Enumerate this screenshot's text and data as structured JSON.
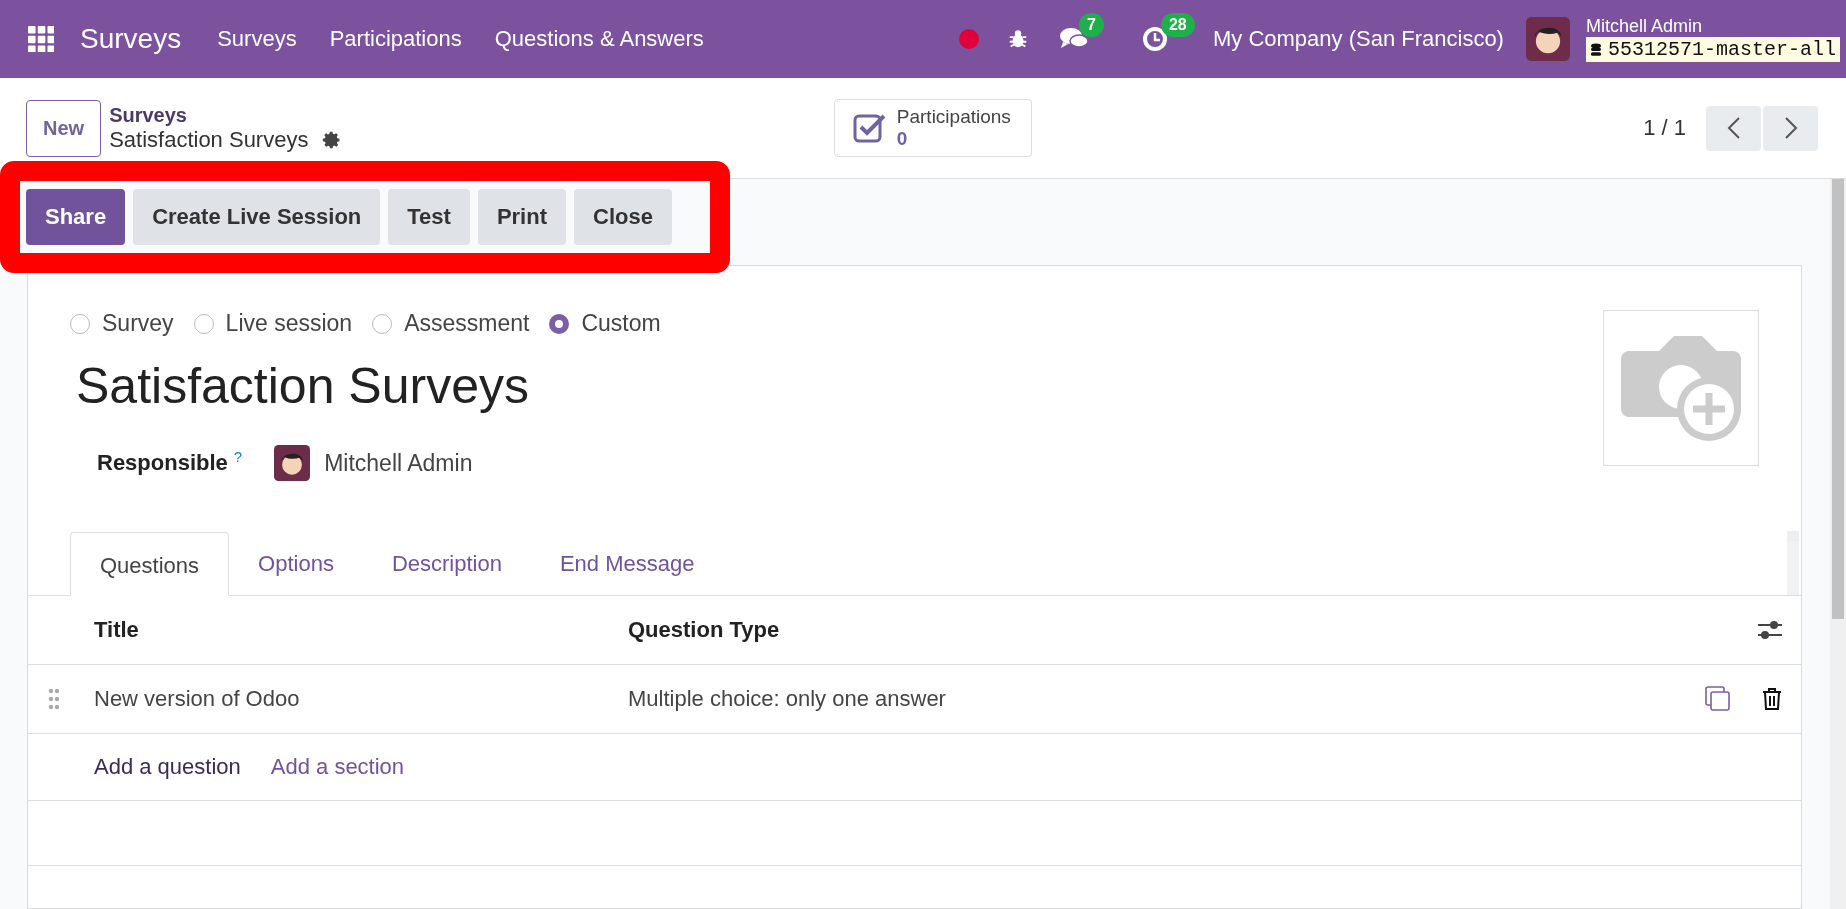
{
  "navbar": {
    "app_name": "Surveys",
    "menu": [
      "Surveys",
      "Participations",
      "Questions & Answers"
    ],
    "messages_count": "7",
    "activities_count": "28",
    "company": "My Company (San Francisco)",
    "user_name": "Mitchell Admin",
    "database": "55312571-master-all"
  },
  "control_panel": {
    "new_button": "New",
    "breadcrumb_parent": "Surveys",
    "breadcrumb_current": "Satisfaction Surveys",
    "stat_button": {
      "label": "Participations",
      "value": "0"
    },
    "pager": "1 / 1"
  },
  "action_buttons": [
    {
      "label": "Share",
      "kind": "primary"
    },
    {
      "label": "Create Live Session",
      "kind": "secondary"
    },
    {
      "label": "Test",
      "kind": "secondary"
    },
    {
      "label": "Print",
      "kind": "secondary"
    },
    {
      "label": "Close",
      "kind": "secondary"
    }
  ],
  "form": {
    "survey_types": [
      {
        "label": "Survey",
        "selected": false
      },
      {
        "label": "Live session",
        "selected": false
      },
      {
        "label": "Assessment",
        "selected": false
      },
      {
        "label": "Custom",
        "selected": true
      }
    ],
    "title": "Satisfaction Surveys",
    "responsible_label": "Responsible",
    "help_mark": "?",
    "responsible": "Mitchell Admin",
    "tabs": [
      {
        "label": "Questions",
        "selected": true
      },
      {
        "label": "Options",
        "selected": false
      },
      {
        "label": "Description",
        "selected": false
      },
      {
        "label": "End Message",
        "selected": false
      }
    ],
    "table": {
      "columns": [
        "Title",
        "Question Type"
      ],
      "rows": [
        [
          "New version of Odoo",
          "Multiple choice: only one answer"
        ]
      ],
      "add_links": [
        "Add a question",
        "Add a section"
      ]
    }
  }
}
